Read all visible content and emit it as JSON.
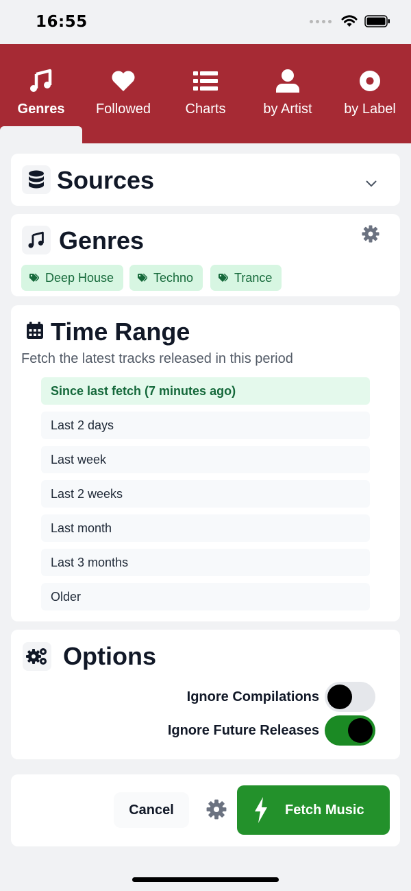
{
  "status_bar": {
    "time": "16:55"
  },
  "tabs": [
    {
      "label": "Genres",
      "icon": "music-note-icon",
      "active": true
    },
    {
      "label": "Followed",
      "icon": "heart-icon",
      "active": false
    },
    {
      "label": "Charts",
      "icon": "list-icon",
      "active": false
    },
    {
      "label": "by Artist",
      "icon": "user-icon",
      "active": false
    },
    {
      "label": "by Label",
      "icon": "disc-icon",
      "active": false
    }
  ],
  "sources": {
    "title": "Sources",
    "icon": "database-icon",
    "expand_icon": "chevron-down-icon"
  },
  "genres": {
    "title": "Genres",
    "icon": "music-note-icon",
    "settings_icon": "gear-icon",
    "tags": [
      "Deep House",
      "Techno",
      "Trance"
    ]
  },
  "time_range": {
    "title": "Time Range",
    "icon": "calendar-icon",
    "subtitle": "Fetch the latest tracks released in this period",
    "options": [
      "Since last fetch (7 minutes ago)",
      "Last 2 days",
      "Last week",
      "Last 2 weeks",
      "Last month",
      "Last 3 months",
      "Older"
    ],
    "selected": "Since last fetch (7 minutes ago)"
  },
  "options": {
    "title": "Options",
    "icon": "gears-icon",
    "toggles": [
      {
        "label": "Ignore Compilations",
        "on": false
      },
      {
        "label": "Ignore Future Releases",
        "on": true
      }
    ]
  },
  "footer": {
    "cancel_label": "Cancel",
    "settings_icon": "gear-icon",
    "fetch_label": "Fetch Music",
    "fetch_icon": "bolt-icon"
  },
  "colors": {
    "brand": "#a62a34",
    "tag_bg": "#d7f6e2",
    "tag_text": "#15693a",
    "primary_button": "#23912b",
    "toggle_on": "#1b8a24"
  }
}
